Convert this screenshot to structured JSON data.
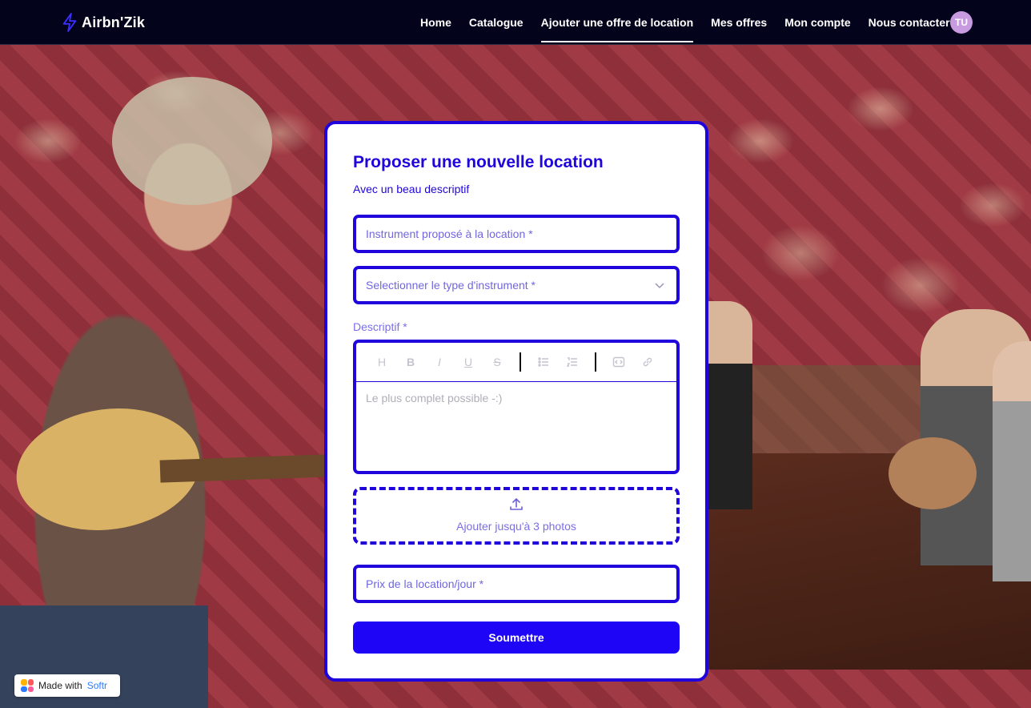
{
  "brand": {
    "name": "Airbn'Zik",
    "accent": "#1f05db"
  },
  "nav": {
    "items": [
      {
        "label": "Home"
      },
      {
        "label": "Catalogue"
      },
      {
        "label": "Ajouter une offre de location",
        "active": true
      },
      {
        "label": "Mes offres"
      },
      {
        "label": "Mon compte"
      },
      {
        "label": "Nous contacter"
      }
    ],
    "avatar": "TU"
  },
  "form": {
    "title": "Proposer une nouvelle location",
    "subtitle": "Avec un beau descriptif",
    "instrument_placeholder": "Instrument proposé à la location *",
    "type_placeholder": "Selectionner le type d'instrument *",
    "description_label": "Descriptif *",
    "description_placeholder": "Le plus complet possible  -:)",
    "upload_label": "Ajouter jusqu'à 3 photos",
    "price_placeholder": "Prix de la location/jour *",
    "submit_label": "Soumettre"
  },
  "editor_toolbar": [
    "heading-icon",
    "bold-icon",
    "italic-icon",
    "underline-icon",
    "strikethrough-icon",
    "bullet-list-icon",
    "numbered-list-icon",
    "code-icon",
    "link-icon"
  ],
  "badge": {
    "text": "Made with",
    "brand": "Softr"
  }
}
